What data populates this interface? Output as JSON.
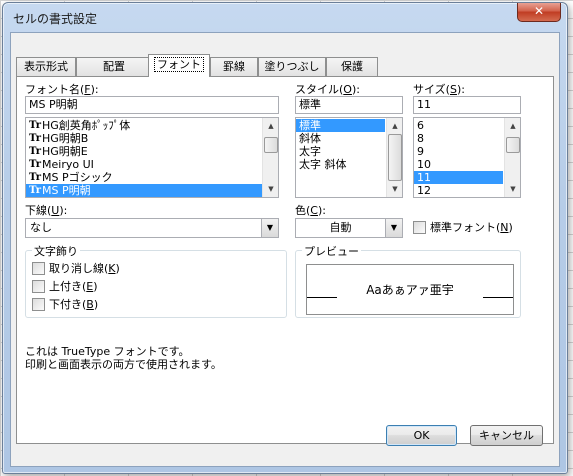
{
  "window": {
    "title": "セルの書式設定",
    "close_label": "✕"
  },
  "tabs": [
    {
      "label": "表示形式"
    },
    {
      "label": "配置"
    },
    {
      "label": "フォント"
    },
    {
      "label": "罫線"
    },
    {
      "label": "塗りつぶし"
    },
    {
      "label": "保護"
    }
  ],
  "font": {
    "label": "フォント名(",
    "key": "F",
    "label_end": "):",
    "value": "MS P明朝",
    "list": [
      {
        "label": "HG創英角ﾎﾟｯﾌﾟ体"
      },
      {
        "label": "HG明朝B"
      },
      {
        "label": "HG明朝E"
      },
      {
        "label": "Meiryo UI"
      },
      {
        "label": "MS Pゴシック"
      },
      {
        "label": "MS P明朝"
      }
    ]
  },
  "style": {
    "label": "スタイル(",
    "key": "O",
    "label_end": "):",
    "value": "標準",
    "list": [
      {
        "label": "標準"
      },
      {
        "label": "斜体"
      },
      {
        "label": "太字"
      },
      {
        "label": "太字 斜体"
      }
    ]
  },
  "size": {
    "label": "サイズ(",
    "key": "S",
    "label_end": "):",
    "value": "11",
    "list": [
      {
        "label": "6"
      },
      {
        "label": "8"
      },
      {
        "label": "9"
      },
      {
        "label": "10"
      },
      {
        "label": "11"
      },
      {
        "label": "12"
      }
    ]
  },
  "underline": {
    "label": "下線(",
    "key": "U",
    "label_end": "):",
    "value": "なし"
  },
  "color": {
    "label": "色(",
    "key": "C",
    "label_end": "):",
    "value": "自動"
  },
  "normal_font": {
    "label": "標準フォント(",
    "key": "N",
    "label_end": ")"
  },
  "effects": {
    "title": "文字飾り",
    "strikethrough": {
      "label": "取り消し線(",
      "key": "K",
      "label_end": ")"
    },
    "superscript": {
      "label": "上付き(",
      "key": "E",
      "label_end": ")"
    },
    "subscript": {
      "label": "下付き(",
      "key": "B",
      "label_end": ")"
    }
  },
  "preview": {
    "title": "プレビュー",
    "sample": "Aaあぁアァ亜宇"
  },
  "info": {
    "line1": "これは TrueType フォントです。",
    "line2": "印刷と画面表示の両方で使用されます。"
  },
  "buttons": {
    "ok": "OK",
    "cancel": "キャンセル"
  },
  "icons": {
    "truetype": "Tr",
    "scroll_up": "▲",
    "scroll_down": "▼",
    "dropdown": "▼"
  }
}
